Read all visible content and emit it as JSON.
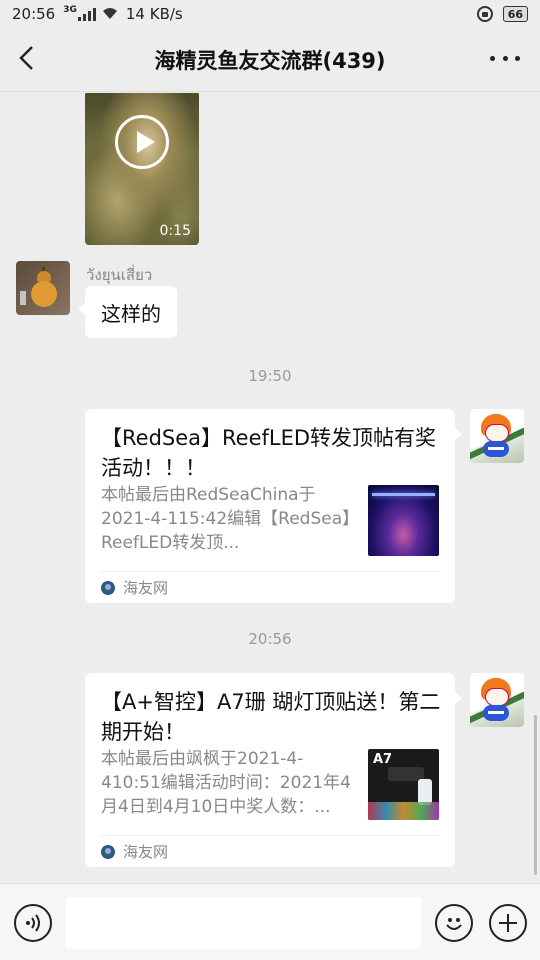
{
  "status_bar": {
    "time": "20:56",
    "network": "3G",
    "speed": "14 KB/s",
    "battery": "66"
  },
  "header": {
    "title": "海精灵鱼友交流群(439)"
  },
  "messages": {
    "video": {
      "duration": "0:15"
    },
    "text_msg": {
      "sender": "วังยุนเสี่ยว",
      "text": "这样的"
    },
    "time_1": "19:50",
    "card_1": {
      "title": "【RedSea】ReefLED转发顶帖有奖活动！！！",
      "desc": "本帖最后由RedSeaChina于2021-4-115:42编辑【RedSea】ReefLED转发顶...",
      "source": "海友网"
    },
    "time_2": "20:56",
    "card_2": {
      "title": "【A+智控】A7珊 瑚灯顶贴送！第二期开始！",
      "desc": "本帖最后由飒枫于2021-4-410:51编辑活动时间：2021年4月4日到4月10日中奖人数：...",
      "source": "海友网",
      "thumb_label": "A7"
    }
  },
  "input": {
    "placeholder": ""
  },
  "colors": {
    "background": "#ededed",
    "bubble": "#ffffff",
    "meta_text": "#999999"
  }
}
